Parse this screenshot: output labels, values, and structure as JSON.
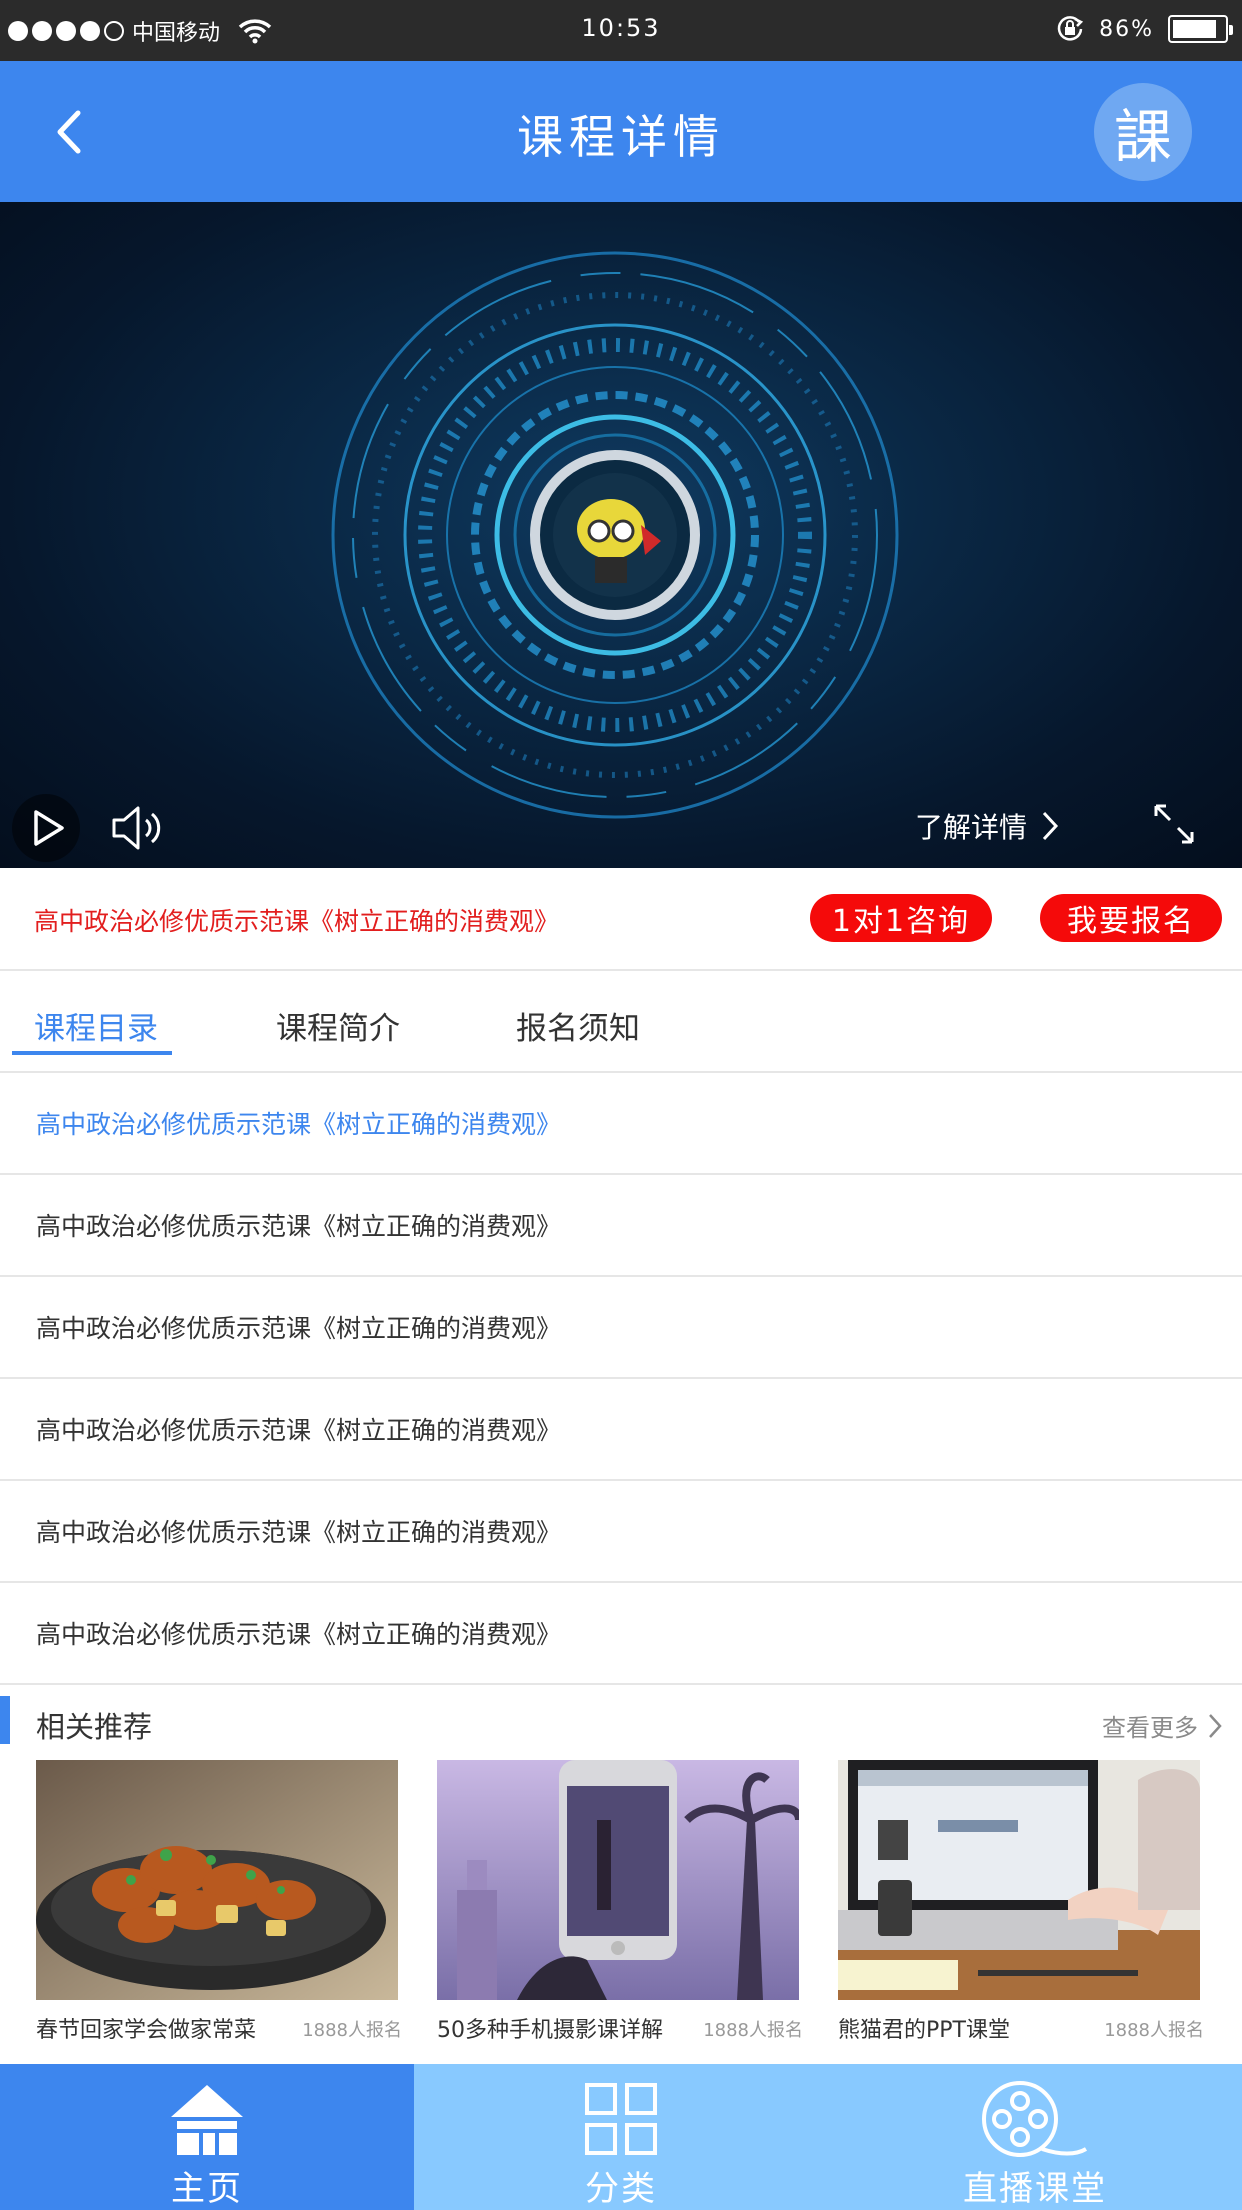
{
  "status_bar": {
    "carrier": "中国移动",
    "time": "10:53",
    "battery": "86%",
    "battery_level": 0.86
  },
  "header": {
    "title": "课程详情",
    "logo_text": "課"
  },
  "video": {
    "detail_link": "了解详情"
  },
  "course": {
    "title": "高中政治必修优质示范课《树立正确的消费观》",
    "consult_label": "1对1咨询",
    "enroll_label": "我要报名"
  },
  "tabs": [
    {
      "label": "课程目录",
      "active": true
    },
    {
      "label": "课程简介",
      "active": false
    },
    {
      "label": "报名须知",
      "active": false
    }
  ],
  "lessons": [
    {
      "title": "高中政治必修优质示范课《树立正确的消费观》",
      "active": true
    },
    {
      "title": "高中政治必修优质示范课《树立正确的消费观》",
      "active": false
    },
    {
      "title": "高中政治必修优质示范课《树立正确的消费观》",
      "active": false
    },
    {
      "title": "高中政治必修优质示范课《树立正确的消费观》",
      "active": false
    },
    {
      "title": "高中政治必修优质示范课《树立正确的消费观》",
      "active": false
    },
    {
      "title": "高中政治必修优质示范课《树立正确的消费观》",
      "active": false
    }
  ],
  "recommend": {
    "title": "相关推荐",
    "more": "查看更多",
    "cards": [
      {
        "name": "春节回家学会做家常菜",
        "count": "1888人报名",
        "image": "food-dish"
      },
      {
        "name": "50多种手机摄影课详解",
        "count": "1888人报名",
        "image": "phone-photography"
      },
      {
        "name": "熊猫君的PPT课堂",
        "count": "1888人报名",
        "image": "laptop-desk"
      }
    ]
  },
  "tabbar": [
    {
      "label": "主页",
      "icon": "home-icon"
    },
    {
      "label": "分类",
      "icon": "grid-icon"
    },
    {
      "label": "直播课堂",
      "icon": "film-reel-icon"
    }
  ],
  "colors": {
    "primary": "#3d86ee",
    "accent_red": "#f50a0a",
    "tabbar_light": "#88c9ff"
  }
}
